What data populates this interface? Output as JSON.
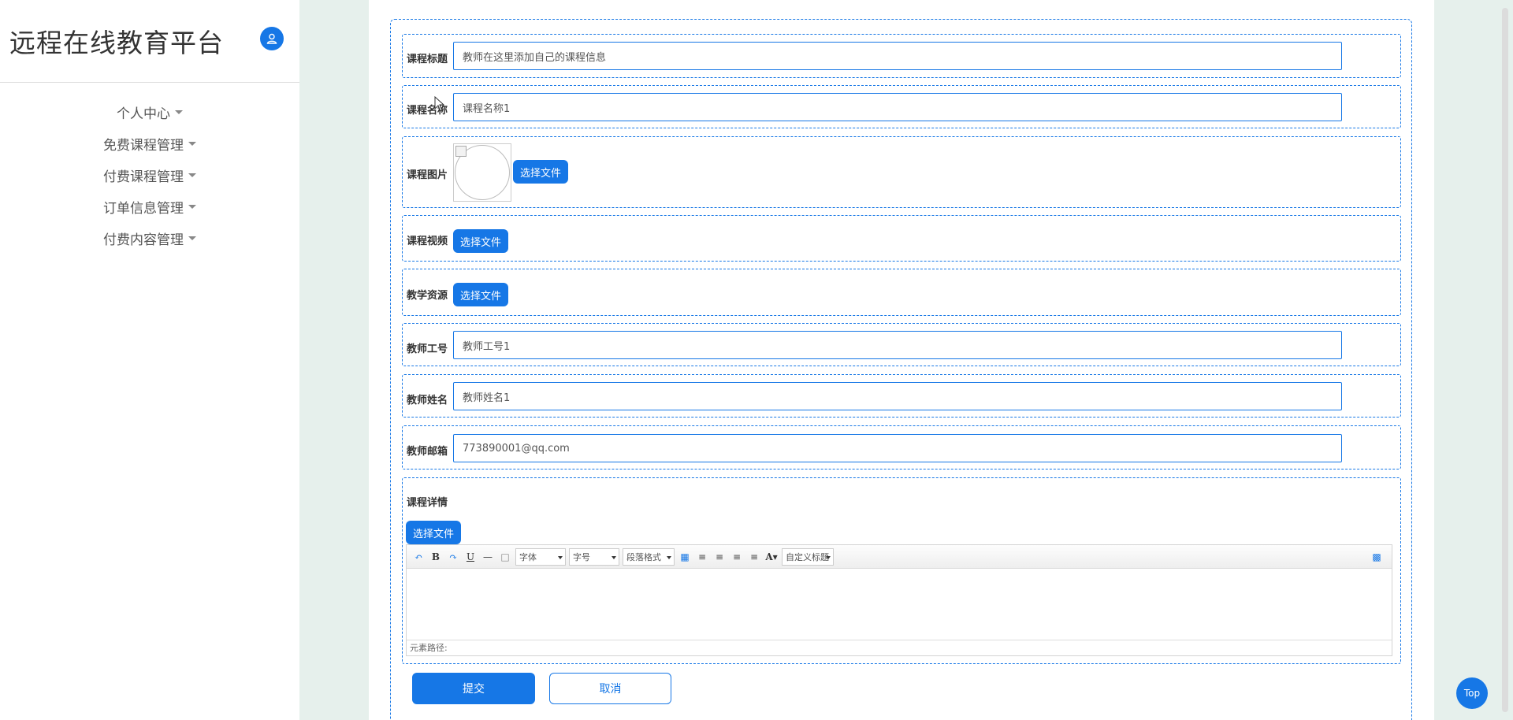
{
  "app": {
    "title": "远程在线教育平台"
  },
  "sidebar": {
    "items": [
      {
        "label": "个人中心"
      },
      {
        "label": "免费课程管理"
      },
      {
        "label": "付费课程管理"
      },
      {
        "label": "订单信息管理"
      },
      {
        "label": "付费内容管理"
      }
    ]
  },
  "form": {
    "course_title": {
      "label": "课程标题",
      "value": "教师在这里添加自己的课程信息"
    },
    "course_name": {
      "label": "课程名称",
      "value": "课程名称1"
    },
    "course_image": {
      "label": "课程图片",
      "button": "选择文件"
    },
    "course_video": {
      "label": "课程视频",
      "button": "选择文件"
    },
    "teaching_resource": {
      "label": "教学资源",
      "button": "选择文件"
    },
    "teacher_id": {
      "label": "教师工号",
      "value": "教师工号1"
    },
    "teacher_name": {
      "label": "教师姓名",
      "value": "教师姓名1"
    },
    "teacher_email": {
      "label": "教师邮箱",
      "value": "773890001@qq.com"
    },
    "course_detail": {
      "label": "课程详情",
      "button": "选择文件"
    }
  },
  "editor": {
    "font_family": "字体",
    "font_size": "字号",
    "paragraph": "段落格式",
    "custom_title": "自定义标题",
    "status_path": "元素路径:"
  },
  "actions": {
    "submit": "提交",
    "cancel": "取消",
    "top": "Top"
  },
  "colors": {
    "accent": "#1677e6",
    "page_bg": "#e6f0ec"
  }
}
